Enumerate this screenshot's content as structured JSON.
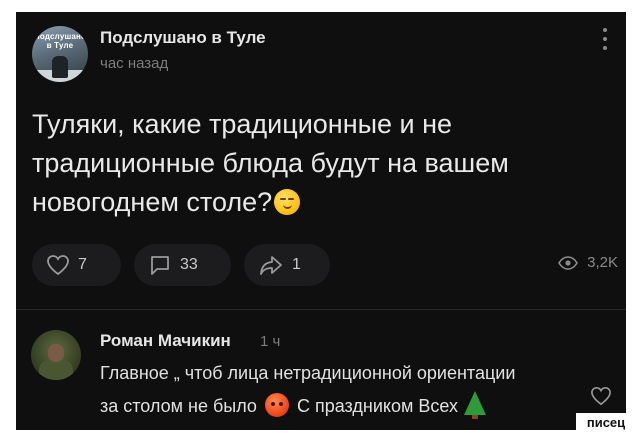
{
  "post": {
    "group_name": "Подслушано в Туле",
    "time": "час назад",
    "avatar_label": "Подслушано в Туле",
    "text_lines": [
      "Туляки, какие традиционные и не",
      "традиционные блюда будут на вашем",
      "новогоднем столе?"
    ],
    "emoji": "smirk-emoji"
  },
  "actions": {
    "likes": "7",
    "comments": "33",
    "shares": "1",
    "views": "3,2K"
  },
  "comment": {
    "author": "Роман Мачикин",
    "time": "1 ч",
    "line1": "Главное „ чтоб лица нетрадиционной ориентации",
    "line2_before": "за столом не было",
    "line2_after": "С праздником Всех",
    "emoji_1": "angry-face-emoji",
    "emoji_2": "christmas-tree-emoji"
  },
  "watermark": "писец",
  "colors": {
    "background": "#0f0f10",
    "pill": "#1c1c1e",
    "text": "#e9e9e9",
    "muted": "#7d7d7d"
  }
}
